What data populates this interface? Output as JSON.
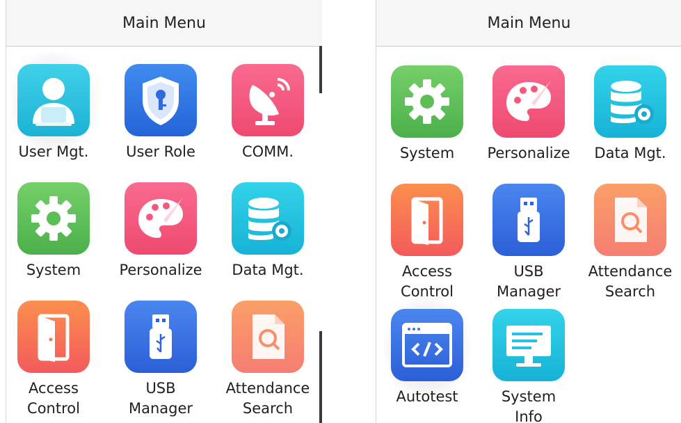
{
  "left_screen": {
    "title": "Main Menu",
    "items": [
      {
        "label": "User Mgt.",
        "icon": "user-icon",
        "color": "#2bbfe0",
        "selected": true
      },
      {
        "label": "User Role",
        "icon": "shield-key-icon",
        "color": "#2f74e4"
      },
      {
        "label": "COMM.",
        "icon": "satellite-dish-icon",
        "color": "#f45a7e"
      },
      {
        "label": "System",
        "icon": "gear-icon",
        "color": "#5ec05a"
      },
      {
        "label": "Personalize",
        "icon": "palette-icon",
        "color": "#f45a7e"
      },
      {
        "label": "Data Mgt.",
        "icon": "database-gear-icon",
        "color": "#2bbfe0"
      },
      {
        "label": "Access\nControl",
        "icon": "door-icon",
        "color": "#f7744f"
      },
      {
        "label": "USB\nManager",
        "icon": "usb-drive-icon",
        "color": "#2f74e4"
      },
      {
        "label": "Attendance\nSearch",
        "icon": "document-search-icon",
        "color": "#f98d6a"
      }
    ]
  },
  "right_screen": {
    "title": "Main Menu",
    "items": [
      {
        "label": "System",
        "icon": "gear-icon",
        "color": "#5ec05a"
      },
      {
        "label": "Personalize",
        "icon": "palette-icon",
        "color": "#f45a7e"
      },
      {
        "label": "Data Mgt.",
        "icon": "database-gear-icon",
        "color": "#2bbfe0"
      },
      {
        "label": "Access\nControl",
        "icon": "door-icon",
        "color": "#f7744f"
      },
      {
        "label": "USB\nManager",
        "icon": "usb-drive-icon",
        "color": "#2f74e4"
      },
      {
        "label": "Attendance\nSearch",
        "icon": "document-search-icon",
        "color": "#f98d6a"
      },
      {
        "label": "Autotest",
        "icon": "code-window-icon",
        "color": "#3b74e6",
        "selected": true
      },
      {
        "label": "System\nInfo",
        "icon": "monitor-icon",
        "color": "#23c1e3"
      }
    ]
  }
}
